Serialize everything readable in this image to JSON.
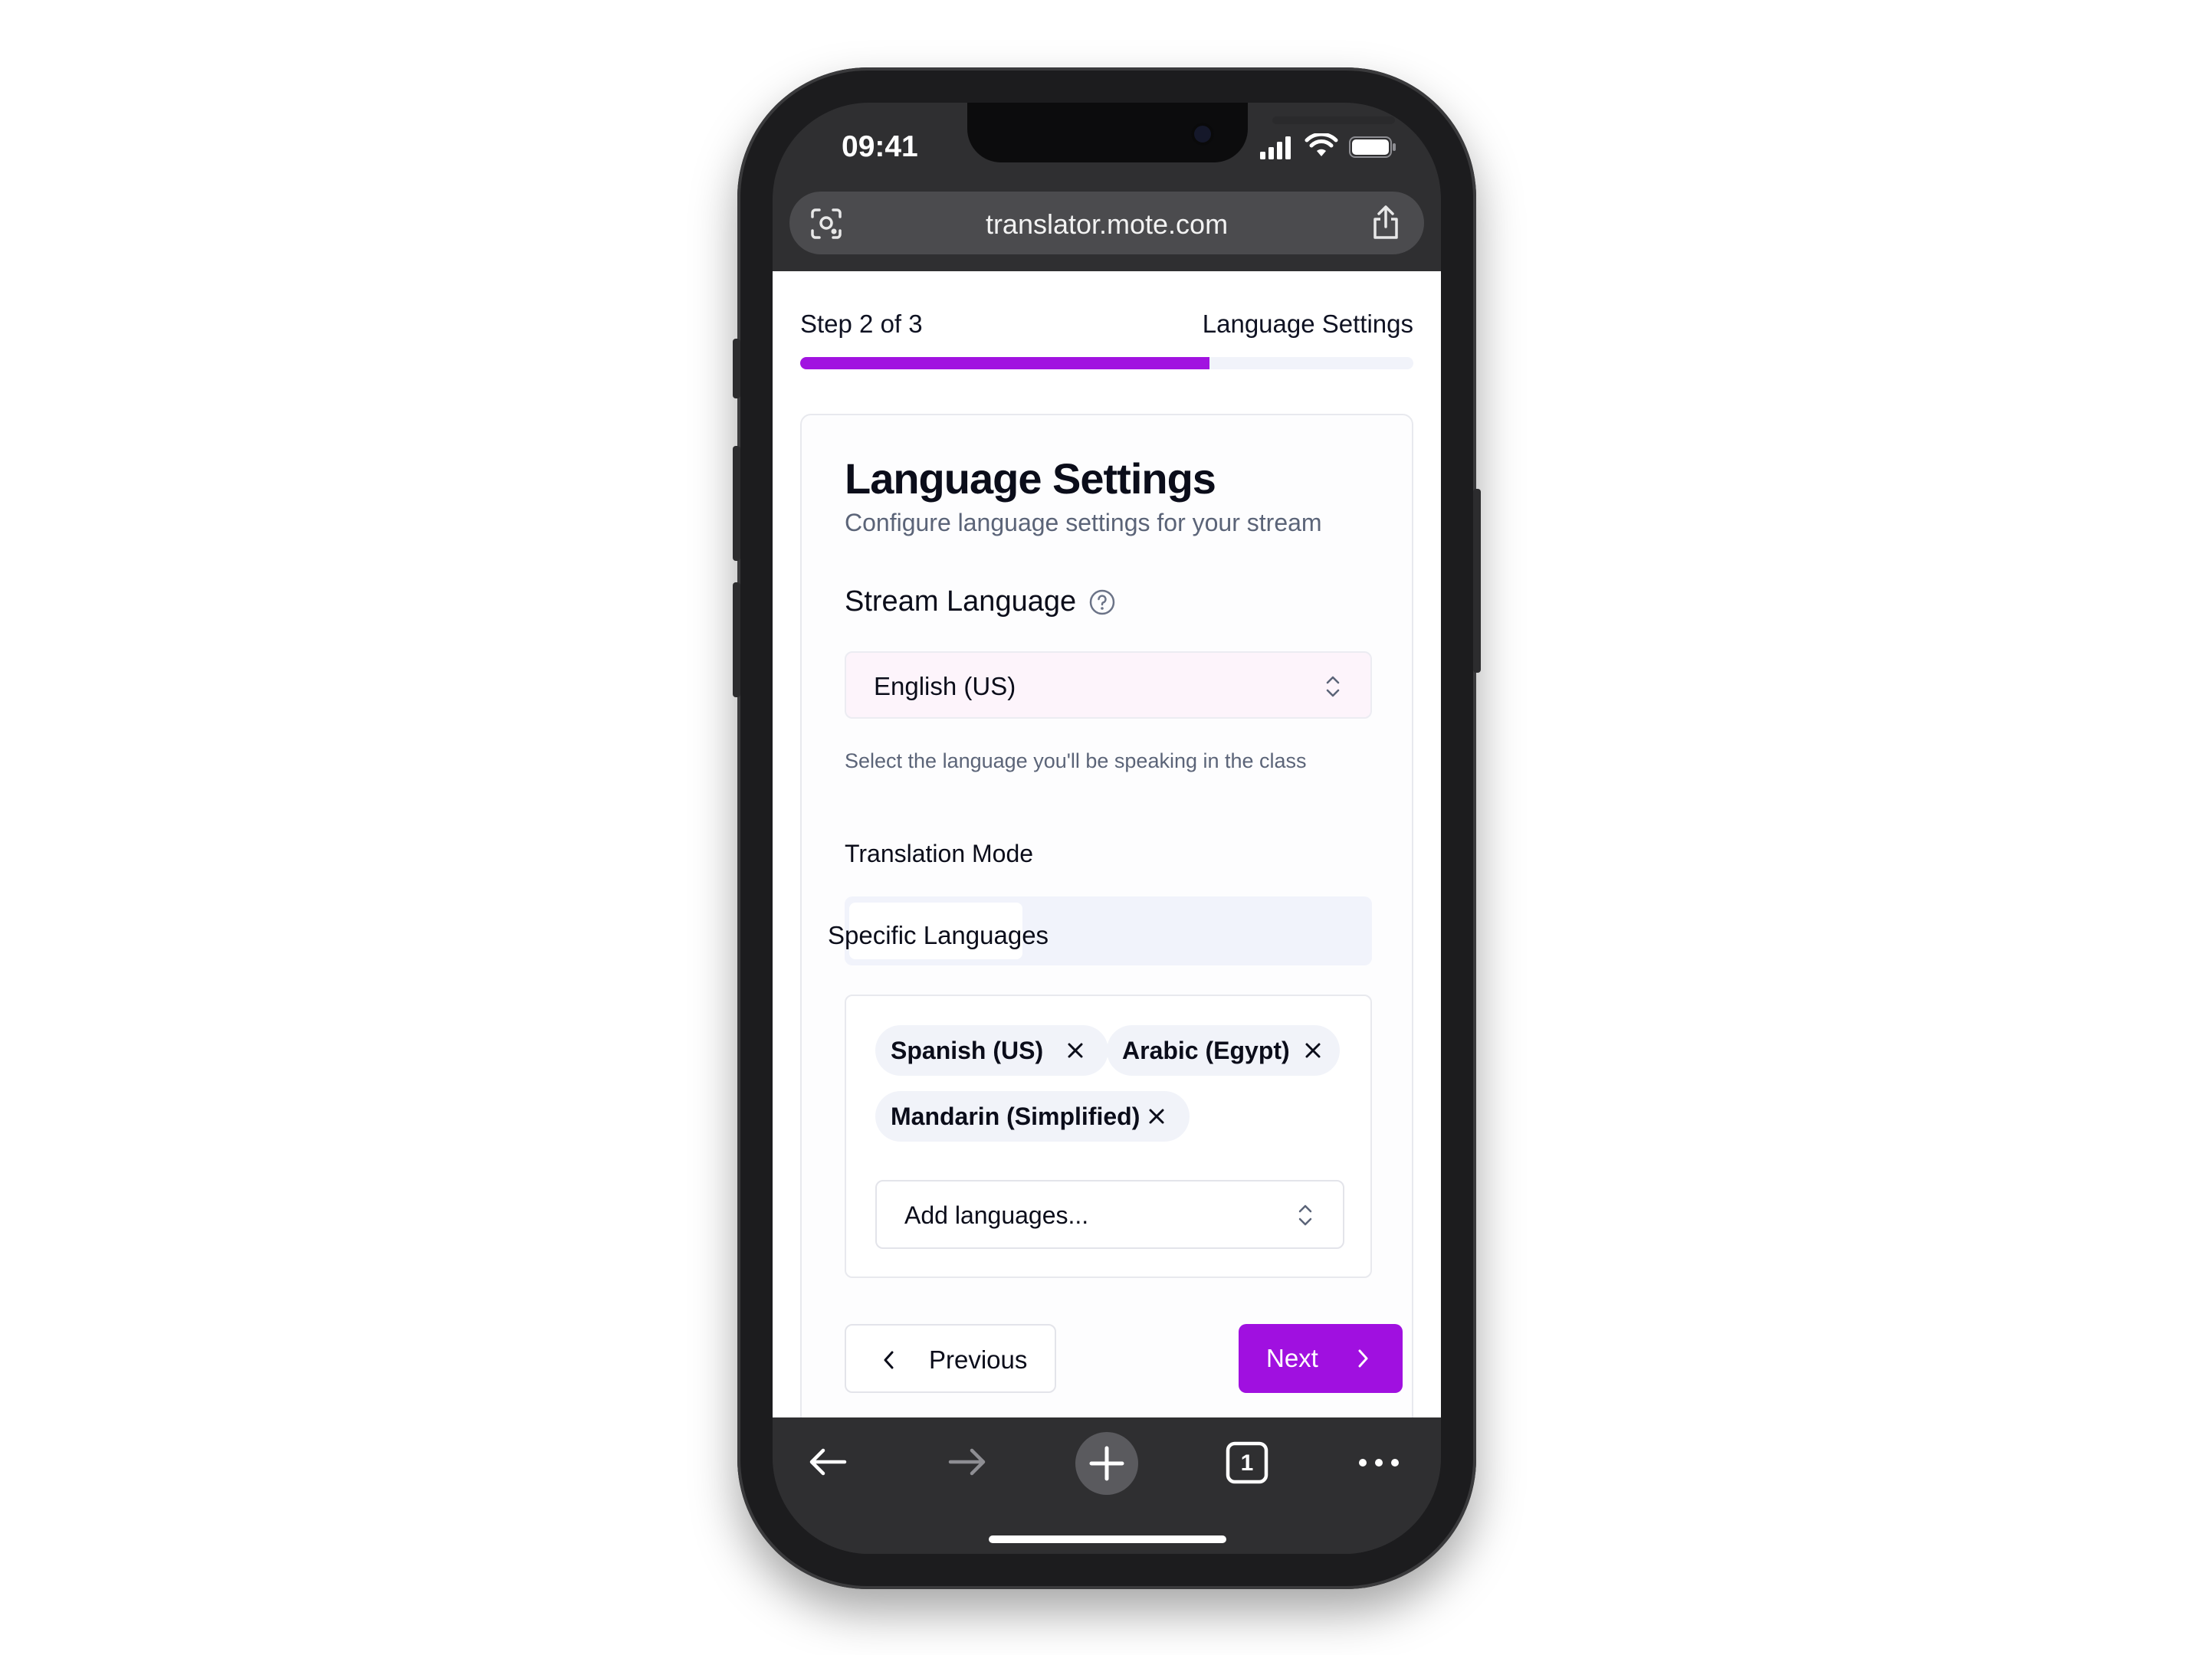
{
  "status_bar": {
    "time": "09:41"
  },
  "browser": {
    "url": "translator.mote.com",
    "tab_count": "1"
  },
  "wizard": {
    "step_text": "Step 2 of 3",
    "step_title": "Language Settings",
    "progress_fraction": 0.667,
    "accent_color": "#a113e0"
  },
  "card": {
    "title": "Language Settings",
    "subtitle": "Configure language settings for your stream",
    "stream_language": {
      "label": "Stream Language",
      "value": "English (US)",
      "helper": "Select the language you'll be speaking in the class"
    },
    "translation_mode": {
      "label": "Translation Mode",
      "selected_option": "Specific Languages"
    },
    "languages": {
      "chips": [
        "Spanish (US)",
        "Arabic (Egypt)",
        "Mandarin (Simplified)"
      ],
      "add_placeholder": "Add languages..."
    }
  },
  "actions": {
    "previous_label": "Previous",
    "next_label": "Next"
  },
  "icons": {
    "camera_lens": "lens-icon",
    "share": "share-icon",
    "help": "help-circle-icon",
    "select_chevron": "chevron-up-down-icon",
    "remove": "x-icon",
    "back": "arrow-left-icon",
    "forward": "arrow-right-icon",
    "new_tab": "plus-icon",
    "tabs": "tabs-icon",
    "more": "more-icon"
  }
}
